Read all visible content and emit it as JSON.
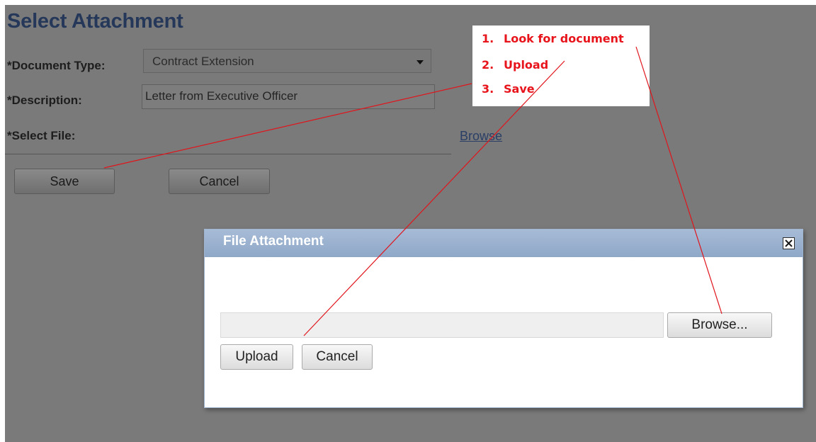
{
  "form": {
    "title": "Select Attachment",
    "document_type_label": "*Document Type:",
    "document_type_value": "Contract Extension",
    "description_label": "*Description:",
    "description_value": "Letter from Executive Officer",
    "select_file_label": "*Select File:",
    "browse_link": "Browse",
    "save_label": "Save",
    "cancel_label": "Cancel"
  },
  "annotation": {
    "steps": [
      {
        "num": "1.",
        "text": "Look for document"
      },
      {
        "num": "2.",
        "text": "Upload"
      },
      {
        "num": "3.",
        "text": "Save"
      }
    ],
    "color": "#e8141c"
  },
  "dialog": {
    "title": "File Attachment",
    "file_input_value": "",
    "browse_label": "Browse...",
    "upload_label": "Upload",
    "cancel_label": "Cancel",
    "header_color": "#9db3d1"
  },
  "colors": {
    "overlay": "#7a7a7a",
    "title": "#25385a"
  }
}
